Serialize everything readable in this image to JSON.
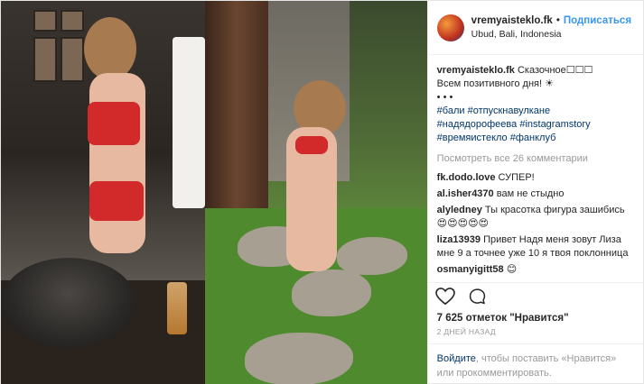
{
  "header": {
    "username": "vremyaisteklo.fk",
    "separator": "•",
    "follow_label": "Подписаться",
    "location": "Ubud, Bali, Indonesia"
  },
  "caption": {
    "username": "vremyaisteklo.fk",
    "line1": "Сказочное☐☐☐",
    "line2": "Всем позитивного дня! ☀",
    "line3": "•  •  •",
    "tags": [
      "#бали",
      "#отпускнавулкане",
      "#надядорофеева",
      "#instagramstory",
      "#времяистекло",
      "#фанклуб"
    ]
  },
  "view_all_comments": "Посмотреть все 26 комментарии",
  "comments": [
    {
      "user": "fk.dodo.love",
      "text": "СУПЕР!"
    },
    {
      "user": "al.isher4370",
      "text": "вам не стыдно"
    },
    {
      "user": "alyledney",
      "text": "Ты красотка фигура зашибись 😍😍😍😍😍"
    },
    {
      "user": "liza13939",
      "text": "Привет Надя меня зовут Лиза мне 9 а точнее уже 10 я твоя поклонница"
    },
    {
      "user": "osmanyigitt58",
      "text": "😊"
    }
  ],
  "likes": "7 625 отметок \"Нравится\"",
  "timestamp": "2 ДНЕЙ НАЗАД",
  "login_prompt": {
    "login_link": "Войдите",
    "rest": ", чтобы поставить «Нравится» или прокомментировать."
  },
  "icons": {
    "like": "heart-outline-icon",
    "comment": "comment-bubble-icon"
  },
  "colors": {
    "link_blue": "#3897f0",
    "hashtag": "#003569",
    "muted": "#999999"
  }
}
